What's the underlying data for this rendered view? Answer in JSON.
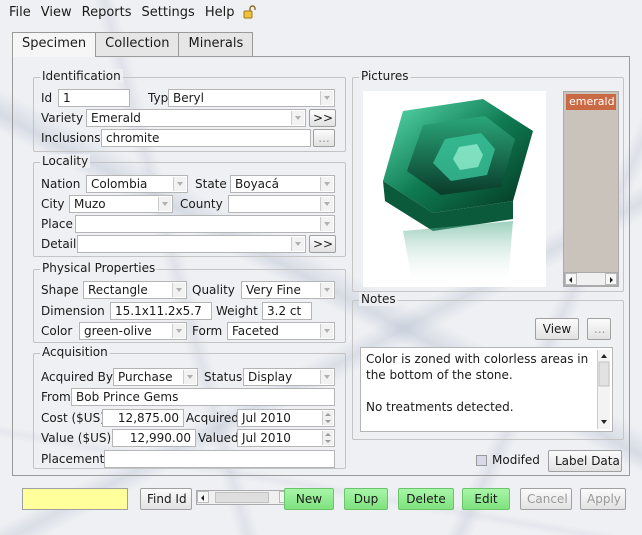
{
  "menu": [
    "File",
    "View",
    "Reports",
    "Settings",
    "Help"
  ],
  "tabs": [
    "Specimen",
    "Collection",
    "Minerals"
  ],
  "identification": {
    "title": "Identification",
    "id_label": "Id",
    "id_value": "1",
    "type_label": "Type",
    "type_value": "Beryl",
    "variety_label": "Variety",
    "variety_value": "Emerald",
    "inclusions_label": "Inclusions",
    "inclusions_value": "chromite",
    "more_button": ">>",
    "ellipsis_button": "..."
  },
  "locality": {
    "title": "Locality",
    "nation_label": "Nation",
    "nation_value": "Colombia",
    "state_label": "State",
    "state_value": "Boyacá",
    "city_label": "City",
    "city_value": "Muzo",
    "county_label": "County",
    "county_value": "",
    "place_label": "Place",
    "place_value": "",
    "detail_label": "Detail",
    "detail_value": "",
    "more_button": ">>"
  },
  "physical": {
    "title": "Physical Properties",
    "shape_label": "Shape",
    "shape_value": "Rectangle",
    "quality_label": "Quality",
    "quality_value": "Very Fine",
    "dimension_label": "Dimension",
    "dimension_value": "15.1x11.2x5.7",
    "weight_label": "Weight",
    "weight_value": "3.2 ct",
    "color_label": "Color",
    "color_value": "green-olive",
    "form_label": "Form",
    "form_value": "Faceted"
  },
  "acquisition": {
    "title": "Acquisition",
    "acquired_by_label": "Acquired By",
    "acquired_by_value": "Purchase",
    "status_label": "Status",
    "status_value": "Display",
    "from_label": "From",
    "from_value": "Bob Prince Gems",
    "cost_label": "Cost ($US)",
    "cost_value": "12,875.00",
    "acquired_label": "Acquired",
    "acquired_value": "Jul 2010",
    "value_label": "Value ($US)",
    "value_value": "12,990.00",
    "valued_label": "Valued",
    "valued_value": "Jul 2010",
    "placement_label": "Placement",
    "placement_value": ""
  },
  "pictures": {
    "title": "Pictures",
    "items": [
      "emerald"
    ]
  },
  "notes": {
    "title": "Notes",
    "view_button": "View",
    "ellipsis_button": "...",
    "paragraphs": [
      "Color is zoned with colorless areas in the bottom of the stone.",
      "No treatments detected."
    ]
  },
  "modified_label": "Modifed",
  "label_data_button": "Label Data",
  "bottom": {
    "status_value": "",
    "find_id": "Find Id",
    "new": "New",
    "dup": "Dup",
    "delete": "Delete",
    "edit": "Edit",
    "cancel": "Cancel",
    "apply": "Apply"
  },
  "colors": {
    "accent_green": "#8fec8f",
    "status_yellow": "#ffff9c",
    "selected_item": "#c96a45",
    "emerald": "#1d8a5e"
  }
}
